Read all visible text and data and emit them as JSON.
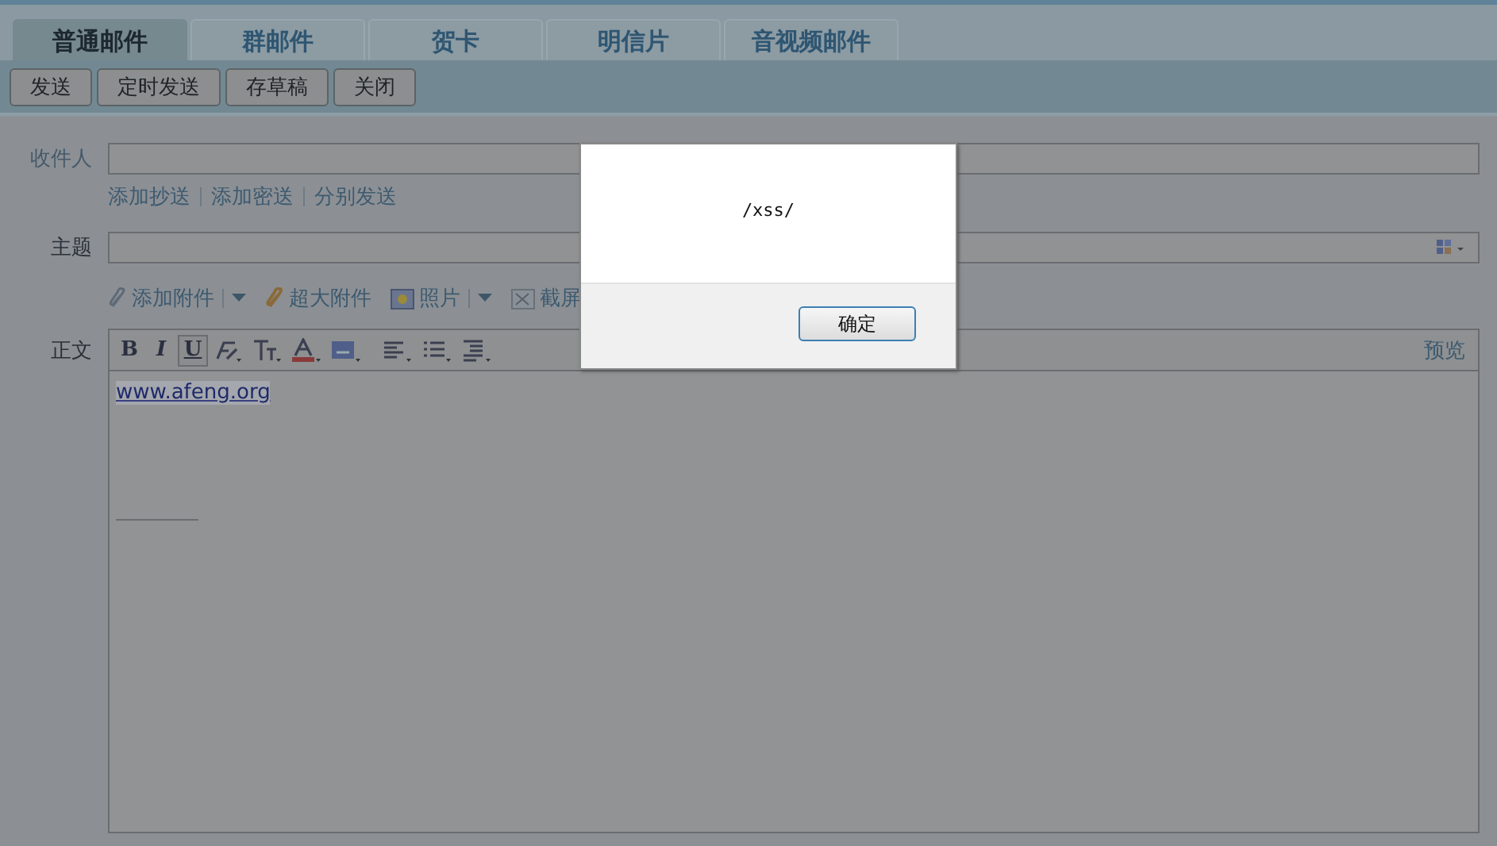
{
  "tabs": [
    {
      "label": "普通邮件",
      "selected": true
    },
    {
      "label": "群邮件",
      "selected": false
    },
    {
      "label": "贺卡",
      "selected": false
    },
    {
      "label": "明信片",
      "selected": false
    },
    {
      "label": "音视频邮件",
      "selected": false
    }
  ],
  "actions": [
    "发送",
    "定时发送",
    "存草稿",
    "关闭"
  ],
  "recipient": {
    "label": "收件人"
  },
  "recipient_links": [
    "添加抄送",
    "添加密送",
    "分别发送"
  ],
  "subject": {
    "label": "主题"
  },
  "attachments": [
    {
      "kind": "attach",
      "label": "添加附件",
      "menu": true
    },
    {
      "kind": "large",
      "label": "超大附件",
      "menu": false
    },
    {
      "kind": "photo",
      "label": "照片",
      "menu": true
    },
    {
      "kind": "screenshot",
      "label": "截屏",
      "menu": false
    }
  ],
  "format_tools": [
    {
      "kind": "letter",
      "glyph": "B",
      "on": false
    },
    {
      "kind": "letter",
      "glyph": "I",
      "on": false
    },
    {
      "kind": "letter",
      "glyph": "U",
      "on": true
    },
    {
      "kind": "clear",
      "on": false
    },
    {
      "kind": "size",
      "on": false
    },
    {
      "kind": "color",
      "on": false
    },
    {
      "kind": "highlight",
      "on": false
    },
    {
      "kind": "align",
      "on": false
    },
    {
      "kind": "list",
      "on": false
    },
    {
      "kind": "indent",
      "on": false
    }
  ],
  "body": {
    "label": "正文",
    "preview": "预览",
    "link": "www.afeng.org",
    "link_selected": true
  },
  "alert": {
    "message": "/xss/",
    "button": "确定"
  }
}
